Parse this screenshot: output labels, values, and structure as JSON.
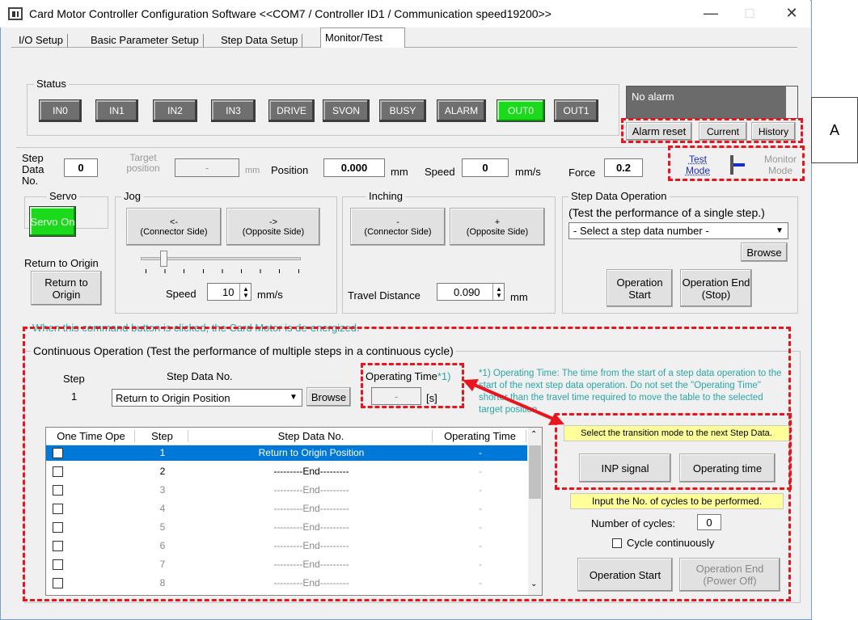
{
  "window": {
    "title": "Card Motor Controller Configuration Software <<COM7 / Controller ID1 / Communication speed19200>>",
    "minimize": "—",
    "maximize": "□",
    "close": "✕"
  },
  "tabs": [
    {
      "label": "I/O Setup"
    },
    {
      "label": "Basic Parameter Setup"
    },
    {
      "label": "Step Data Setup"
    },
    {
      "label": "Monitor/Test"
    }
  ],
  "status": {
    "group_label": "Status",
    "lamps": [
      "IN0",
      "IN1",
      "IN2",
      "IN3",
      "DRIVE",
      "SVON",
      "BUSY",
      "ALARM",
      "OUT0",
      "OUT1"
    ],
    "alarm_text": "No alarm",
    "alarm_reset": "Alarm reset",
    "current": "Current",
    "history": "History",
    "annotation": "A"
  },
  "monitor": {
    "step_data_label": "Step Data No.",
    "step_data_value": "0",
    "target_label": "Target position",
    "target_value": "-",
    "target_unit": "mm",
    "position_label": "Position",
    "position_value": "0.000",
    "position_unit": "mm",
    "speed_label": "Speed",
    "speed_value": "0",
    "speed_unit": "mm/s",
    "force_label": "Force",
    "force_value": "0.2",
    "test_mode": "Test Mode",
    "monitor_mode": "Monitor Mode"
  },
  "servo": {
    "group_label": "Servo",
    "button": "Servo On",
    "return_label": "Return to Origin",
    "return_button": "Return to Origin"
  },
  "jog": {
    "group_label": "Jog",
    "minus_arrow": "<-",
    "minus_label": "(Connector Side)",
    "plus_arrow": "->",
    "plus_label": "(Opposite Side)",
    "speed_label": "Speed",
    "speed_value": "10",
    "speed_unit": "mm/s"
  },
  "inching": {
    "group_label": "Inching",
    "minus_sign": "-",
    "minus_label": "(Connector Side)",
    "plus_sign": "+",
    "plus_label": "(Opposite Side)",
    "distance_label": "Travel Distance",
    "distance_value": "0.090",
    "distance_unit": "mm"
  },
  "step_op": {
    "group_label": "Step Data Operation",
    "subtitle": "(Test the performance of a single step.)",
    "select_value": "- Select a step data number -",
    "browse": "Browse",
    "start": "Operation Start",
    "end": "Operation End (Stop)"
  },
  "notice": "When this command button is clicked, the Card Motor is de-energized.",
  "continuous": {
    "group_label": "Continuous Operation (Test the performance of multiple steps in a continuous cycle)",
    "step_header": "Step",
    "step_value": "1",
    "step_data_header": "Step Data No.",
    "step_data_value": "Return to Origin Position",
    "browse": "Browse",
    "op_time_label": "Operating Time",
    "op_time_note_mark": "*1)",
    "op_time_value": "-",
    "op_time_unit": "[s]",
    "note": "*1) Operating Time: The time from the start of a step data operation to the start of the next step data operation. Do not set the \"Operating Time\" shorter than the travel time required to move the table to the selected target position.",
    "table": {
      "headers": [
        "One Time Ope",
        "Step",
        "Step Data No.",
        "Operating Time"
      ],
      "rows": [
        {
          "checked": true,
          "step": "1",
          "data": "Return to Origin Position",
          "time": "-"
        },
        {
          "checked": false,
          "step": "2",
          "data": "---------End---------",
          "time": "-"
        },
        {
          "checked": false,
          "step": "3",
          "data": "---------End---------",
          "time": "-"
        },
        {
          "checked": false,
          "step": "4",
          "data": "---------End---------",
          "time": "-"
        },
        {
          "checked": false,
          "step": "5",
          "data": "---------End---------",
          "time": "-"
        },
        {
          "checked": false,
          "step": "6",
          "data": "---------End---------",
          "time": "-"
        },
        {
          "checked": false,
          "step": "7",
          "data": "---------End---------",
          "time": "-"
        },
        {
          "checked": false,
          "step": "8",
          "data": "---------End---------",
          "time": "-"
        }
      ]
    },
    "transition_title": "Select the transition mode to the next Step Data.",
    "inp_signal": "INP signal",
    "operating_time": "Operating time",
    "cycles_title": "Input the No. of cycles to be performed.",
    "cycles_label": "Number of cycles:",
    "cycles_value": "0",
    "cycle_continuous": "Cycle continuously",
    "start": "Operation Start",
    "end": "Operation End (Power Off)"
  },
  "colors": {
    "annotation_red": "#e8141e",
    "selection_blue": "#0078d7",
    "lamp_on": "#1bd91b",
    "lamp_off": "#6f6f6f",
    "note_teal": "#2aa6a6"
  }
}
